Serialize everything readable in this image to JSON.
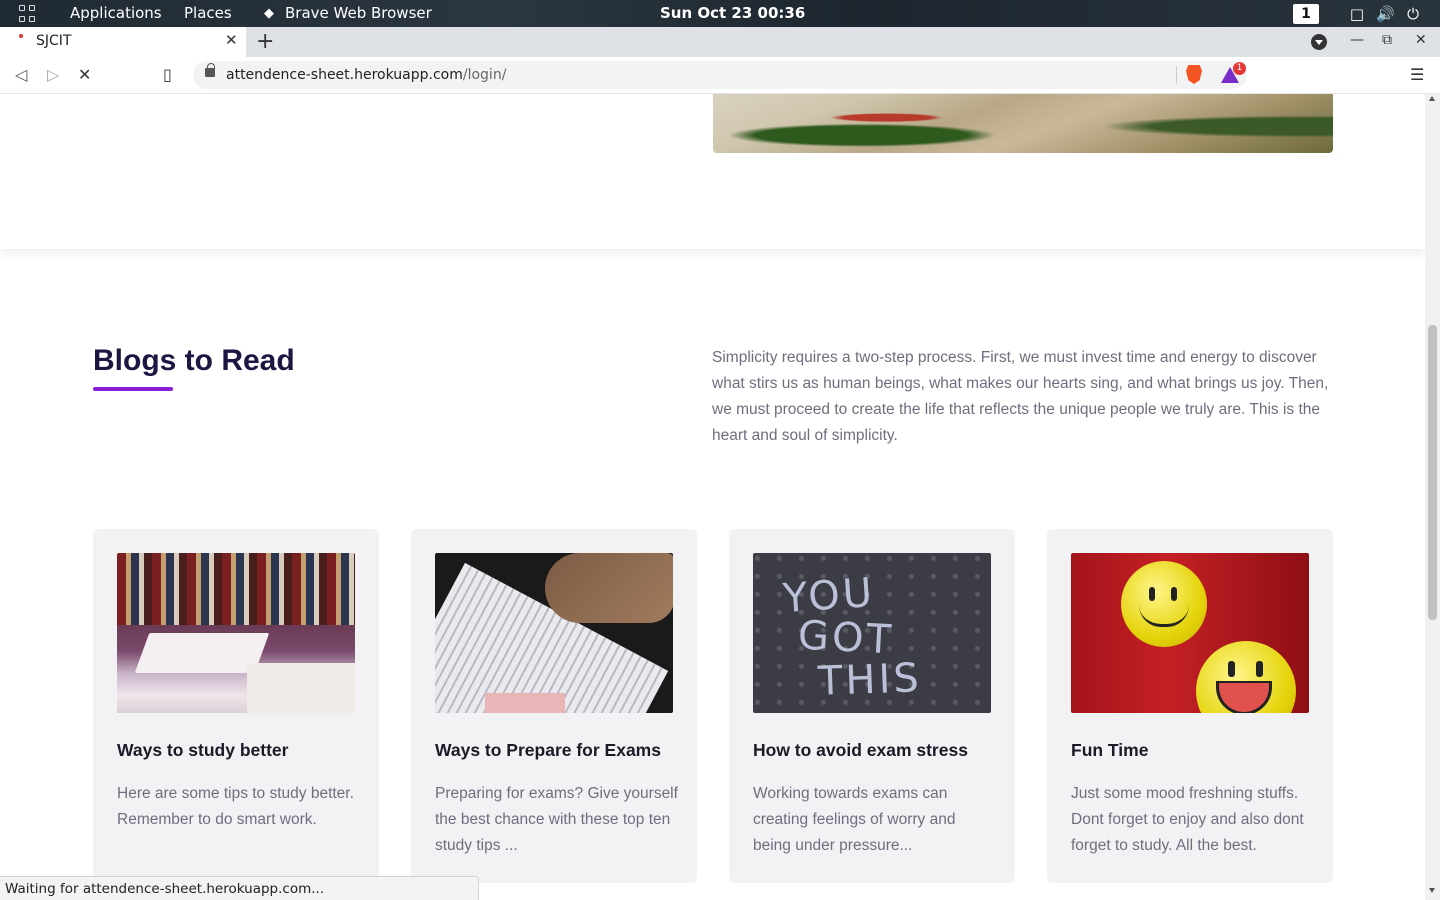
{
  "topbar": {
    "applications": "Applications",
    "places": "Places",
    "active_app": "Brave Web Browser",
    "clock": "Sun Oct 23  00:36",
    "workspace": "1"
  },
  "browser": {
    "tab_title": "SJCIT",
    "url_host": "attendence-sheet.herokuapp.com",
    "url_path": "/login/",
    "rewards_count": "1",
    "status_text": "Waiting for attendence-sheet.herokuapp.com..."
  },
  "section": {
    "title": "Blogs to Read",
    "intro": "Simplicity requires a two-step process. First, we must invest time and energy to discover what stirs us as human beings, what makes our hearts sing, and what brings us joy. Then, we must proceed to create the life that reflects the unique people we truly are. This is the heart and soul of simplicity."
  },
  "cards": [
    {
      "title": "Ways to study better",
      "desc": "Here are some tips to study better. Remember to do smart work."
    },
    {
      "title": "Ways to Prepare for Exams",
      "desc": "Preparing for exams? Give yourself the best chance with these top ten study tips ..."
    },
    {
      "title": "How to avoid exam stress",
      "desc": "Working towards exams can creating feelings of worry and being under pressure..."
    },
    {
      "title": "Fun Time",
      "desc": "Just some mood freshning stuffs. Dont forget to enjoy and also dont forget to study. All the best."
    }
  ],
  "colors": {
    "accent_underline": "#8a1ed6",
    "card_bg": "#f2f2f4",
    "title_color": "#1b1642"
  }
}
